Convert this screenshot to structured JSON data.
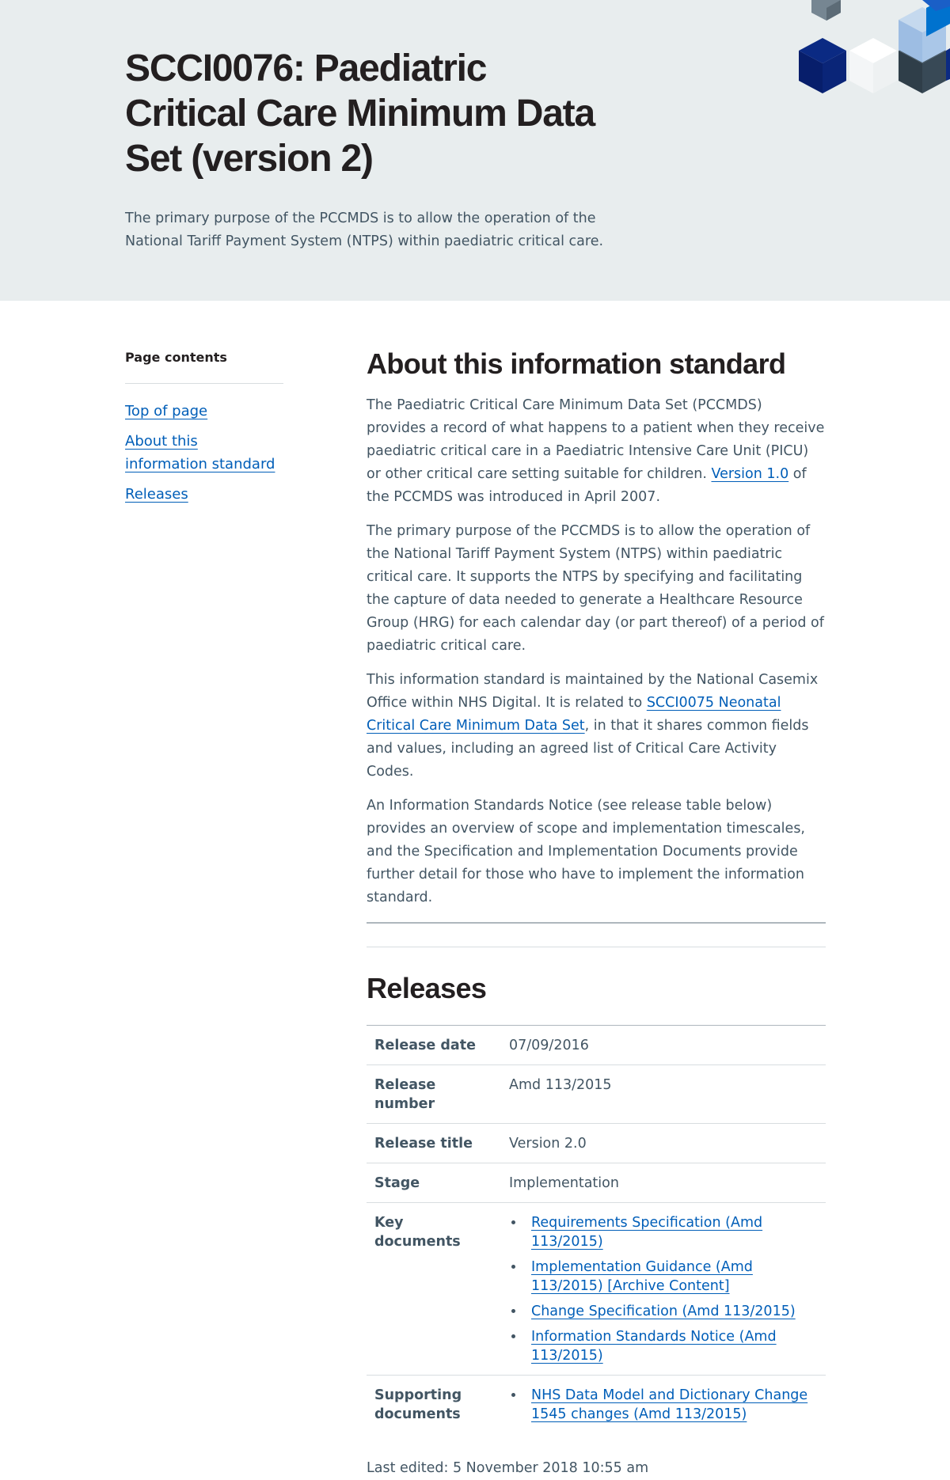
{
  "hero": {
    "title": "SCCI0076: Paediatric Critical Care Minimum Data Set (version 2)",
    "lede": "The primary purpose of the PCCMDS is to allow the operation of the National Tariff Payment System (NTPS) within paediatric critical care."
  },
  "sidebar": {
    "heading": "Page contents",
    "items": [
      {
        "label": "Top of page"
      },
      {
        "label": "About this information standard"
      },
      {
        "label": "Releases"
      }
    ]
  },
  "about": {
    "title": "About this information standard",
    "p1_before": "The Paediatric Critical Care Minimum Data Set (PCCMDS) provides a record of what happens to a patient when they receive paediatric critical care in a Paediatric Intensive Care Unit (PICU) or other critical care setting suitable for children. ",
    "p1_link": "Version 1.0",
    "p1_after": " of the PCCMDS was introduced in April 2007.",
    "p2": "The primary purpose of the PCCMDS is to allow the operation of the National Tariff Payment System (NTPS) within paediatric critical care. It supports the NTPS by specifying and facilitating the capture of data needed to generate a Healthcare Resource Group (HRG) for each calendar day (or part thereof) of a period of paediatric critical care.",
    "p3_before": "This information standard is maintained by the National Casemix Office within NHS Digital. It is related to ",
    "p3_link": "SCCI0075 Neonatal Critical Care Minimum Data Set",
    "p3_after": ", in that it shares common fields and values, including an agreed list of Critical Care Activity Codes.",
    "p4": "An Information Standards Notice (see release table below) provides an overview of scope and implementation timescales, and the Specification and Implementation Documents provide further detail for those who have to implement the information standard."
  },
  "releases": {
    "title": "Releases",
    "rows": {
      "release_date": {
        "label": "Release date",
        "value": "07/09/2016"
      },
      "release_number": {
        "label": "Release number",
        "value": "Amd 113/2015"
      },
      "release_title": {
        "label": "Release title",
        "value": "Version 2.0"
      },
      "stage": {
        "label": "Stage",
        "value": "Implementation"
      }
    },
    "key_documents": {
      "label": "Key documents",
      "links": [
        "Requirements Specification (Amd 113/2015)",
        "Implementation Guidance (Amd 113/2015) [Archive Content]",
        "Change Specification (Amd 113/2015)",
        "Information Standards Notice (Amd 113/2015)"
      ]
    },
    "supporting_documents": {
      "label": "Supporting documents",
      "links": [
        "NHS Data Model and Dictionary Change 1545 changes (Amd 113/2015)"
      ]
    }
  },
  "footer": {
    "last_edited": "Last edited: 5 November 2018 10:55 am"
  },
  "colors": {
    "hero_background": "#e8edee",
    "link": "#005eb8",
    "body_text": "#425563",
    "heading_text": "#231f20"
  }
}
